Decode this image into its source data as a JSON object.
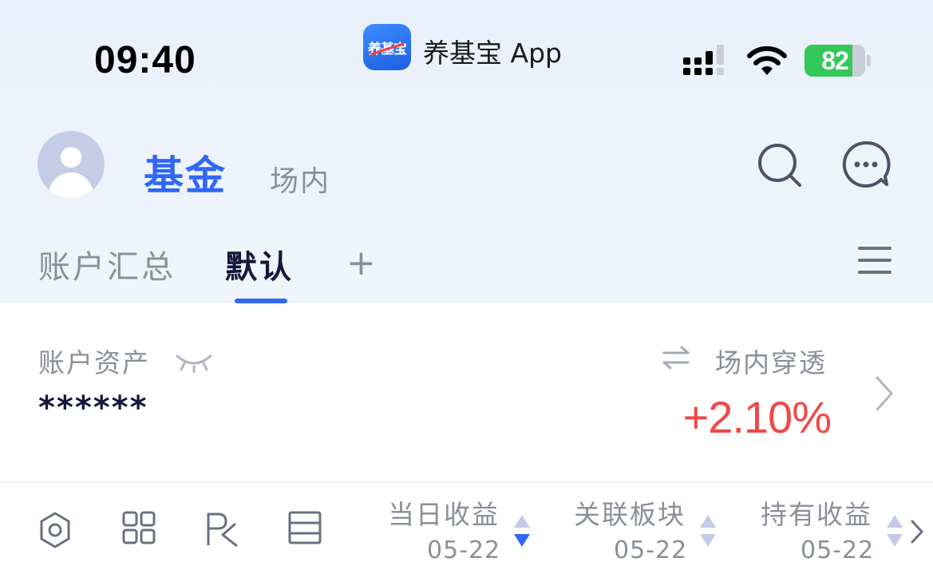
{
  "status_bar": {
    "time": "09:40",
    "app_badge_text": "养基宝",
    "app_name": "养基宝 App",
    "battery_level": "82",
    "icons": [
      "signal-icon",
      "wifi-icon",
      "battery-icon"
    ]
  },
  "header": {
    "tabs": [
      {
        "label": "基金",
        "active": true
      },
      {
        "label": "场内",
        "active": false
      }
    ],
    "icons": [
      "search-icon",
      "chat-icon"
    ]
  },
  "groups": {
    "tabs": [
      {
        "label": "账户汇总",
        "active": false
      },
      {
        "label": "默认",
        "active": true
      }
    ],
    "add_label": "+",
    "icons": [
      "menu-icon"
    ]
  },
  "account": {
    "assets_label": "账户资产",
    "assets_value": "******",
    "penetration_label": "场内穿透",
    "penetration_value": "+2.10%",
    "icons": [
      "eye-closed-icon",
      "swap-icon",
      "chevron-right-icon"
    ]
  },
  "columns": [
    {
      "title": "当日收益",
      "date": "05-22",
      "sort": "desc"
    },
    {
      "title": "关联板块",
      "date": "05-22",
      "sort": "none"
    },
    {
      "title": "持有收益",
      "date": "05-22",
      "sort": "none"
    }
  ],
  "toolbar_icons": [
    "settings-icon",
    "grid-icon",
    "pk-icon",
    "list-icon"
  ],
  "colors": {
    "accent": "#2f67f6",
    "positive": "#f04848",
    "muted": "#8a8f99",
    "battery": "#34c759"
  }
}
